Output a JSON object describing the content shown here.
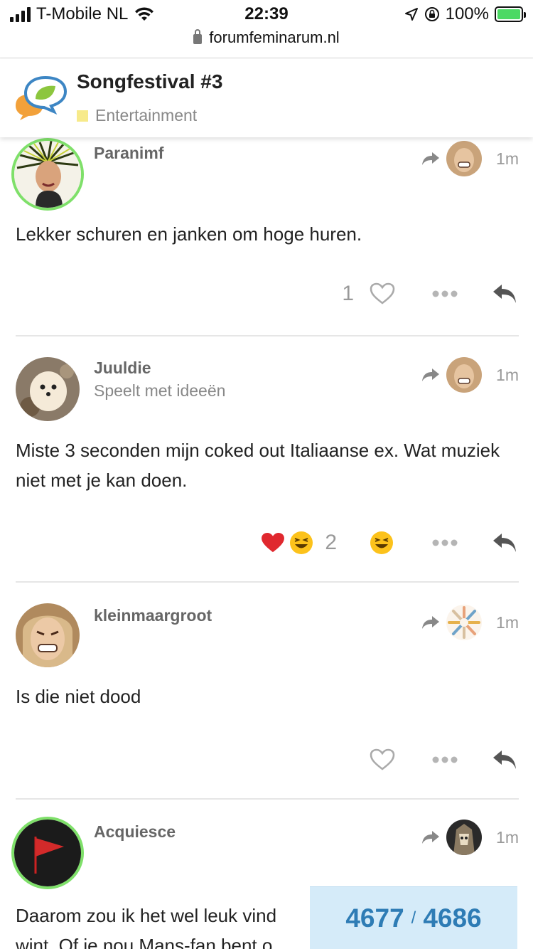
{
  "status_bar": {
    "carrier": "T-Mobile NL",
    "time": "22:39",
    "battery": "100%",
    "url": "forumfeminarum.nl"
  },
  "topic": {
    "title": "Songfestival #3",
    "category": "Entertainment",
    "category_color": "#f7ea8a"
  },
  "posts": [
    {
      "username": "Paranimf",
      "user_title": "",
      "time": "1m",
      "body": "Lekker schuren en janken om hoge huren.",
      "like_count": "1"
    },
    {
      "username": "Juuldie",
      "user_title": "Speelt met ideeën",
      "time": "1m",
      "body": "Miste 3 seconden mijn coked out Italiaanse ex. Wat muziek niet met je kan doen.",
      "reaction_count": "2"
    },
    {
      "username": "kleinmaargroot",
      "user_title": "",
      "time": "1m",
      "body": "Is die niet dood"
    },
    {
      "username": "Acquiesce",
      "user_title": "",
      "time": "1m",
      "body_line1": "Daarom zou ik het wel leuk vind",
      "body_line2": "wint. Of je nou Mans-fan bent o"
    }
  ],
  "progress": {
    "current": "4677",
    "total": "4686"
  },
  "colors": {
    "accent": "#2e7cb5",
    "progress_bg": "#d5ebf9",
    "ring": "#7fe06a",
    "heart": "#e0282e"
  }
}
